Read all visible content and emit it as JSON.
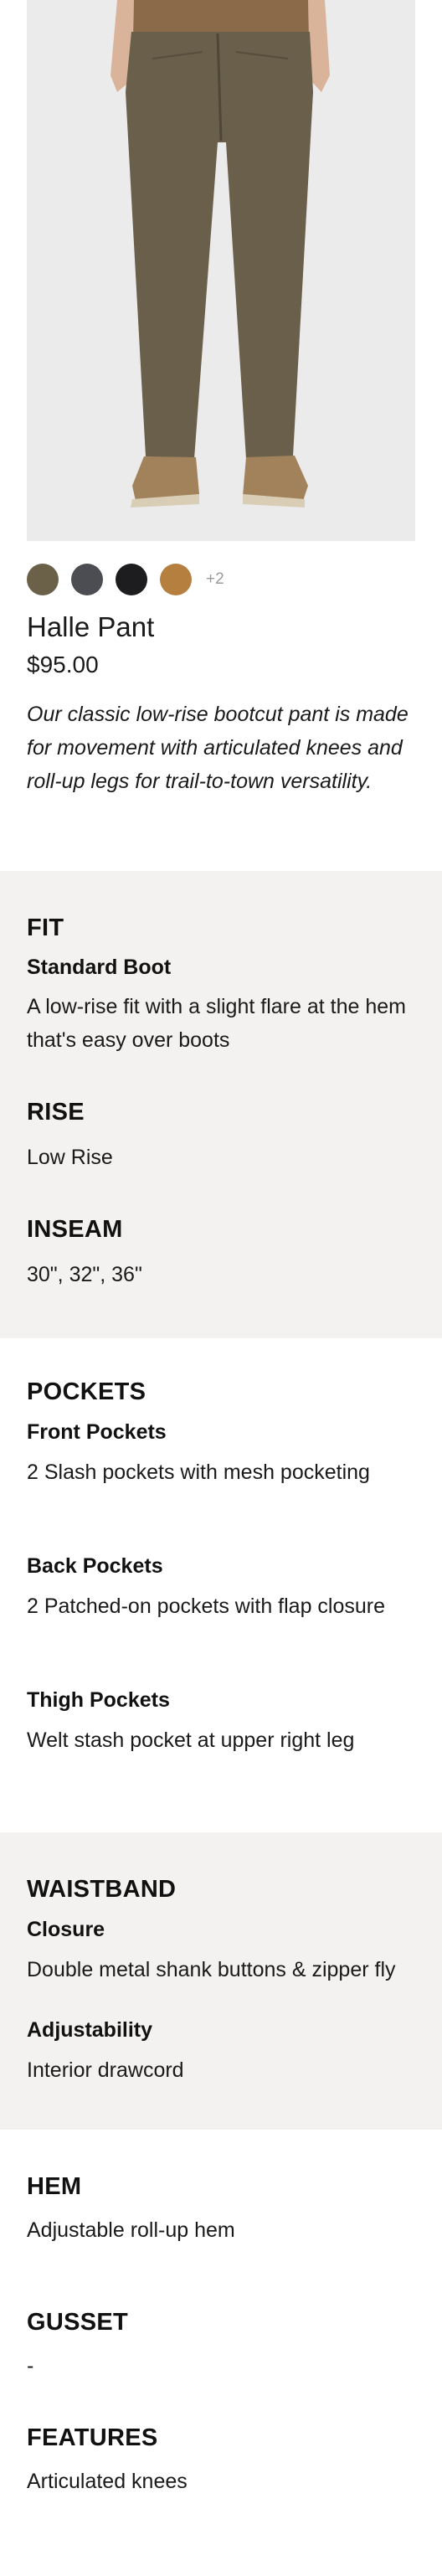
{
  "product": {
    "name": "Halle Pant",
    "price": "$95.00",
    "description": "Our classic low-rise bootcut pant is made for movement with articulated knees and roll-up legs for trail-to-town versatility.",
    "image_icon": "product-photo",
    "swatches": [
      {
        "color": "#6b6148"
      },
      {
        "color": "#4b4d52"
      },
      {
        "color": "#1d1d1f"
      },
      {
        "color": "#b5803f"
      }
    ],
    "more_colors": "+2"
  },
  "fit": {
    "heading": "FIT",
    "sub": "Standard Boot",
    "text": "A low-rise fit with a slight flare at the hem that's easy over boots"
  },
  "rise": {
    "heading": "RISE",
    "text": "Low Rise"
  },
  "inseam": {
    "heading": "INSEAM",
    "text": "30\", 32\", 36\""
  },
  "pockets": {
    "heading": "POCKETS",
    "items": [
      {
        "title": "Front Pockets",
        "text": "2 Slash pockets with mesh pocketing"
      },
      {
        "title": "Back Pockets",
        "text": "2 Patched-on pockets with flap closure"
      },
      {
        "title": "Thigh Pockets",
        "text": "Welt stash pocket at upper right leg"
      }
    ]
  },
  "waistband": {
    "heading": "WAISTBAND",
    "items": [
      {
        "title": "Closure",
        "text": "Double metal shank buttons & zipper fly"
      },
      {
        "title": "Adjustability",
        "text": "Interior drawcord"
      }
    ]
  },
  "hem": {
    "heading": "HEM",
    "text": "Adjustable roll-up hem"
  },
  "gusset": {
    "heading": "GUSSET",
    "text": "-"
  },
  "features": {
    "heading": "FEATURES",
    "text": "Articulated knees"
  }
}
